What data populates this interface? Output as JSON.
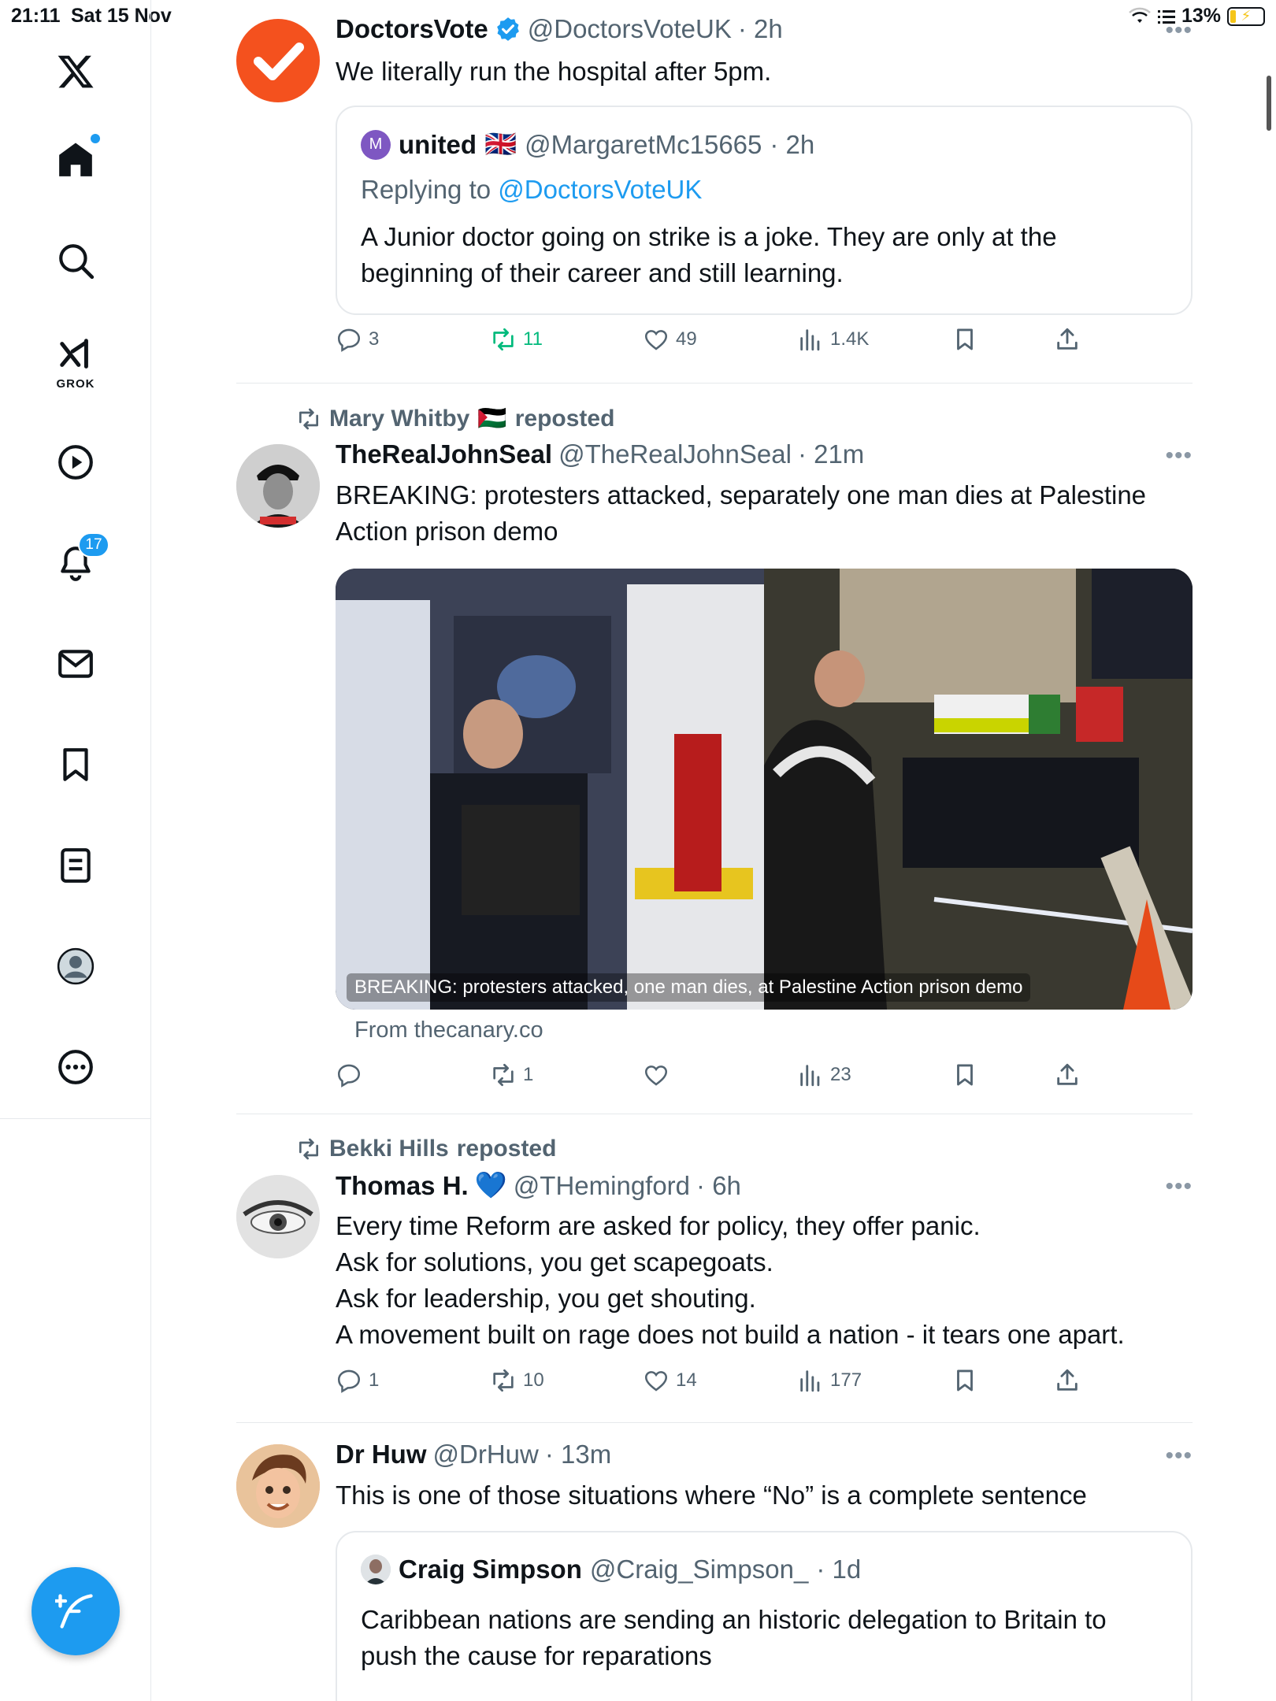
{
  "status_bar": {
    "time": "21:11",
    "date": "Sat 15 Nov",
    "battery": "13%"
  },
  "sidebar": {
    "items": [
      {
        "name": "x-logo-icon"
      },
      {
        "name": "home-icon"
      },
      {
        "name": "search-icon"
      },
      {
        "name": "grok-icon",
        "label": "GROK"
      },
      {
        "name": "video-icon"
      },
      {
        "name": "notifications-icon",
        "badge": "17"
      },
      {
        "name": "messages-icon"
      },
      {
        "name": "bookmarks-icon"
      },
      {
        "name": "lists-icon"
      },
      {
        "name": "profile-icon"
      },
      {
        "name": "more-icon"
      }
    ],
    "compose": "compose-icon",
    "accent": "#1d9bf0"
  },
  "tweets": [
    {
      "name": "DoctorsVote",
      "handle": "@DoctorsVoteUK",
      "time": "· 2h",
      "verified": true,
      "text": "We literally run the hospital after 5pm.",
      "quote": {
        "name": "united",
        "flag": "🇬🇧",
        "handle": "@MargaretMc15665",
        "time": "· 2h",
        "avatar_letter": "M",
        "reply_prefix": "Replying to",
        "reply_to": "@DoctorsVoteUK",
        "text": "A Junior doctor going on strike is a joke. They are only at the beginning of their career and still learning."
      },
      "stats": {
        "replies": "3",
        "reposts": "11",
        "likes": "49",
        "views": "1.4K"
      }
    },
    {
      "repost_by": "Mary Whitby",
      "repost_flag": "🇵🇸",
      "repost_suffix": "reposted",
      "name": "TheRealJohnSeal",
      "handle": "@TheRealJohnSeal",
      "time": "· 21m",
      "text": "BREAKING: protesters attacked, separately one man dies at Palestine Action prison demo",
      "media_caption": "BREAKING: protesters attacked, one man dies, at Palestine Action prison demo",
      "link_source": "From thecanary.co",
      "stats": {
        "replies": "",
        "reposts": "1",
        "likes": "",
        "views": "23"
      }
    },
    {
      "repost_by": "Bekki Hills",
      "repost_suffix": "reposted",
      "name": "Thomas H.",
      "name_emoji": "💙",
      "handle": "@THemingford",
      "time": "· 6h",
      "text": "Every time Reform are asked for policy, they offer panic.\nAsk for solutions, you get scapegoats.\nAsk for leadership, you get shouting.\nA movement built on rage does not build a nation - it tears one apart.",
      "stats": {
        "replies": "1",
        "reposts": "10",
        "likes": "14",
        "views": "177"
      }
    },
    {
      "name": "Dr Huw",
      "handle": "@DrHuw",
      "time": "· 13m",
      "text": "This is one of those situations where “No” is a complete sentence",
      "quote": {
        "name": "Craig Simpson",
        "handle": "@Craig_Simpson_",
        "time": "· 1d",
        "text": "Caribbean nations are sending an historic delegation to Britain to push the cause for reparations"
      }
    }
  ]
}
